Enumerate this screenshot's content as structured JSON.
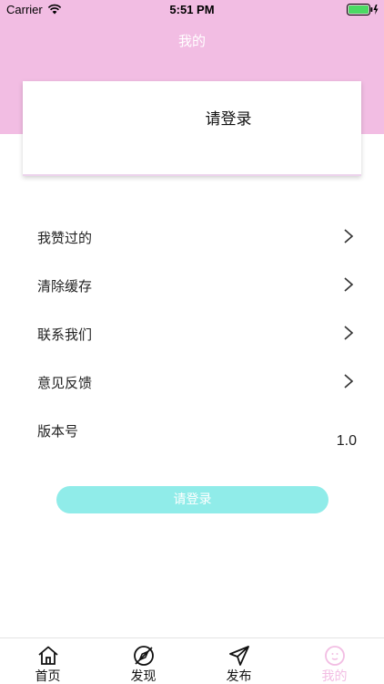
{
  "status_bar": {
    "carrier": "Carrier",
    "time": "5:51 PM"
  },
  "nav": {
    "title": "我的"
  },
  "login_card": {
    "text": "请登录"
  },
  "menu": {
    "items": [
      {
        "label": "我赞过的",
        "icon": "chevron-right-icon"
      },
      {
        "label": "清除缓存",
        "icon": "chevron-right-icon"
      },
      {
        "label": "联系我们",
        "icon": "chevron-right-icon"
      },
      {
        "label": "意见反馈",
        "icon": "chevron-right-icon"
      },
      {
        "label": "版本号",
        "value": "1.0"
      }
    ]
  },
  "login_button": {
    "label": "请登录"
  },
  "tabs": [
    {
      "label": "首页",
      "icon": "home-icon"
    },
    {
      "label": "发现",
      "icon": "compass-icon"
    },
    {
      "label": "发布",
      "icon": "send-icon"
    },
    {
      "label": "我的",
      "icon": "smiley-icon",
      "active": true
    }
  ],
  "colors": {
    "accent": "#f2bde3",
    "button": "#90ece9"
  }
}
